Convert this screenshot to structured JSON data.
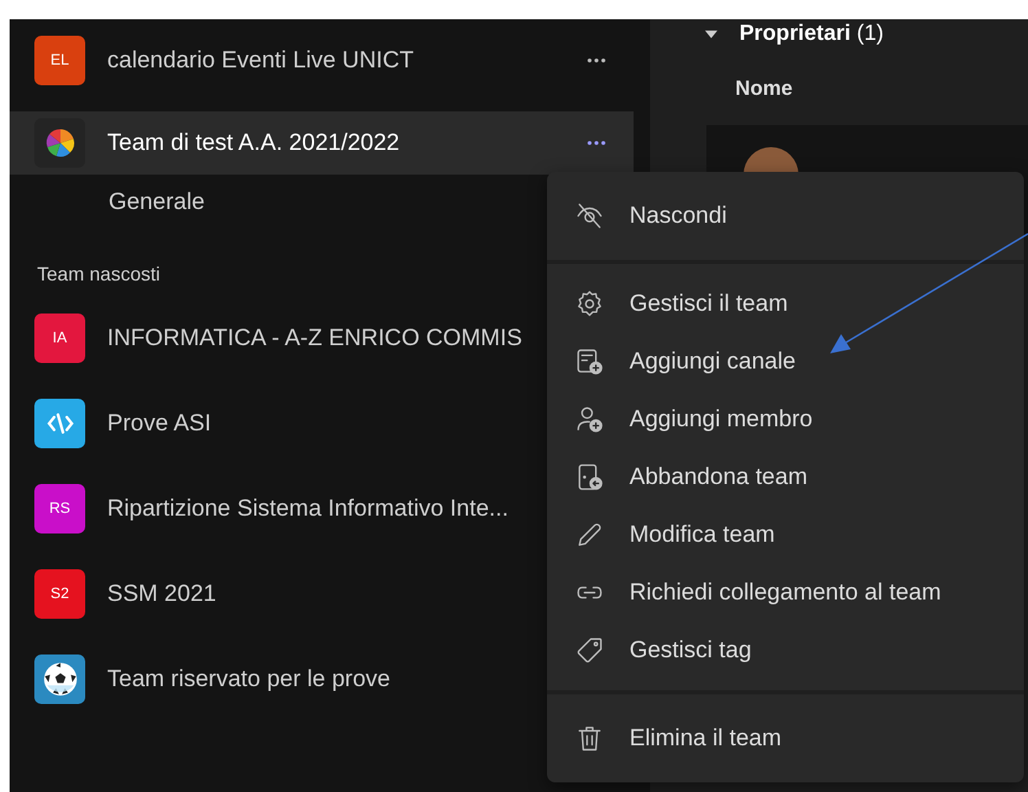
{
  "teams": [
    {
      "name": "calendario Eventi Live UNICT",
      "avatar": {
        "kind": "initials",
        "text": "EL",
        "color": "#d9400f"
      },
      "selected": false,
      "more": true
    },
    {
      "name": "Team di test A.A. 2021/2022",
      "avatar": {
        "kind": "wheel"
      },
      "selected": true,
      "more": true,
      "channels": [
        "Generale"
      ]
    }
  ],
  "hidden_section": {
    "title": "Team nascosti",
    "teams": [
      {
        "name": "INFORMATICA - A-Z ENRICO COMMIS",
        "avatar": {
          "kind": "initials",
          "text": "IA",
          "color": "#e3173e"
        }
      },
      {
        "name": "Prove ASI",
        "avatar": {
          "kind": "code",
          "color": "#27a9e6"
        }
      },
      {
        "name": "Ripartizione Sistema Informativo Inte...",
        "avatar": {
          "kind": "initials",
          "text": "RS",
          "color": "#c90fc9"
        }
      },
      {
        "name": "SSM 2021",
        "avatar": {
          "kind": "initials",
          "text": "S2",
          "color": "#e5121f"
        }
      },
      {
        "name": "Team riservato per le prove",
        "avatar": {
          "kind": "ball",
          "color": "#2b8ac0"
        }
      }
    ]
  },
  "owners": {
    "title": "**Proprietari** (1)",
    "expanded": true,
    "column": "Nome"
  },
  "menu": {
    "sections": [
      [
        "Nascondi"
      ],
      [
        "Gestisci il team",
        "Aggiungi canale",
        "Aggiungi membro",
        "Abbandona team",
        "Modifica team",
        "Richiedi collegamento al team",
        "Gestisci tag"
      ],
      [
        "Elimina il team"
      ]
    ]
  }
}
